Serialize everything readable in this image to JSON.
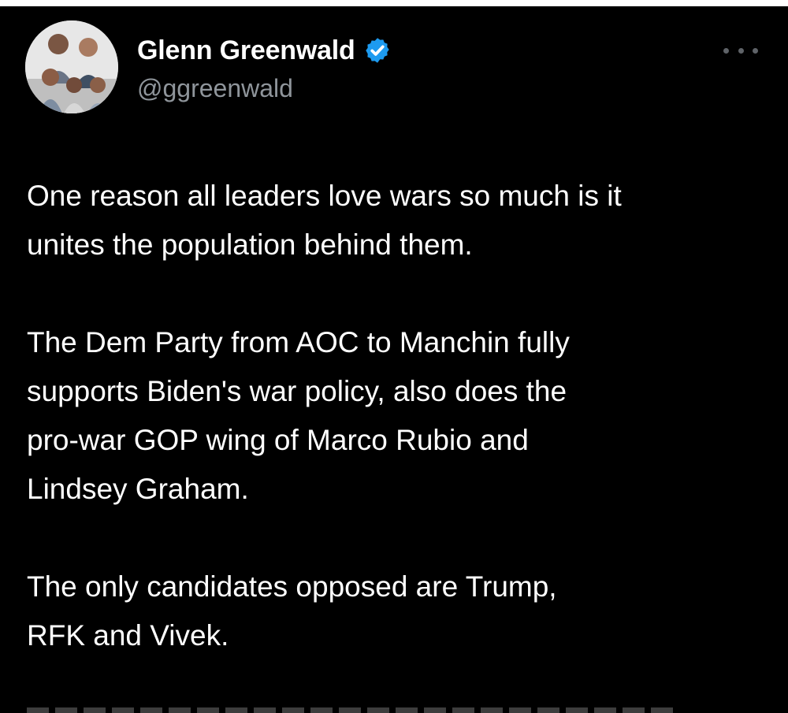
{
  "tweet": {
    "author": {
      "display_name": "Glenn Greenwald",
      "handle": "@ggreenwald",
      "verified": true,
      "avatar": "avatar-photo"
    },
    "paragraphs": [
      "One reason all leaders love wars so much is it\nunites the population behind them.",
      "The Dem Party from AOC to Manchin fully\nsupports Biden's war policy, also does the\npro-war GOP wing of Marco Rubio and\nLindsey Graham.",
      "The only candidates opposed are Trump,\nRFK and Vivek."
    ],
    "more_menu_icon": "more-horizontal-icon"
  },
  "theme": {
    "background": "#000000",
    "text": "#ffffff",
    "secondary_text": "#8f959b",
    "verified_badge": "#1d9bf0"
  }
}
